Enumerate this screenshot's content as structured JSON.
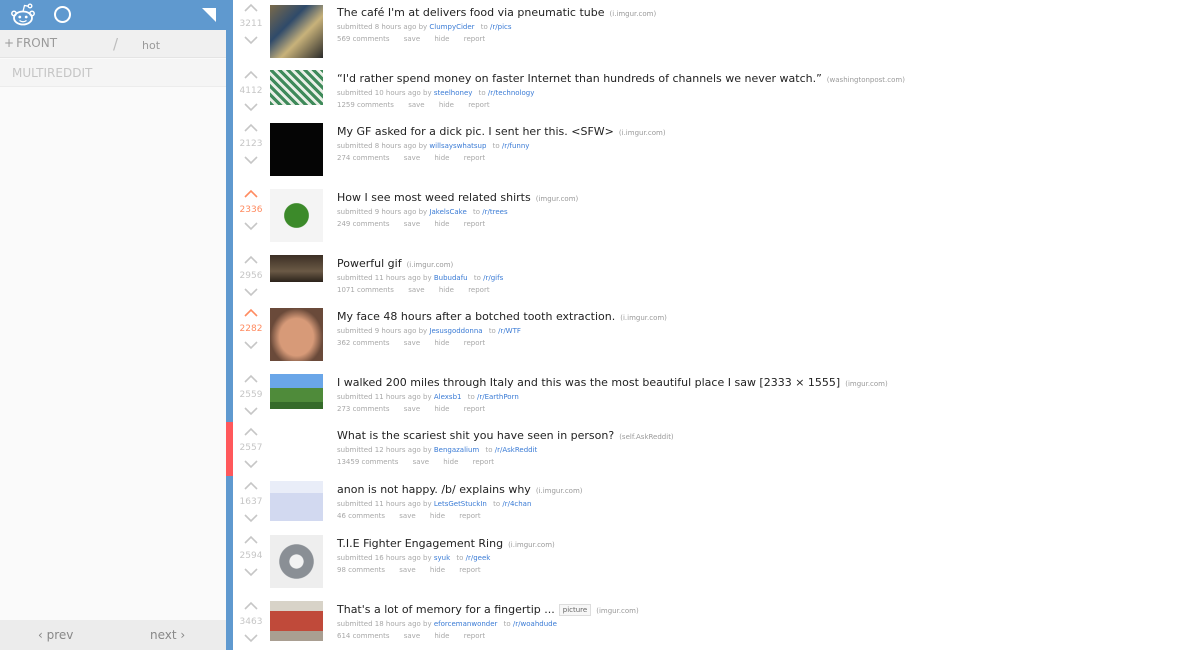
{
  "sidebar": {
    "front_label": "FRONT",
    "sort_label": "hot",
    "multireddit_label": "MULTIREDDIT",
    "prev_label": "‹ prev",
    "next_label": "next ›"
  },
  "colors": {
    "accent": "#5f99cf",
    "upvoted": "#ff8b60",
    "link": "#3a7bd5",
    "marker": "#ff585b"
  },
  "icons": {
    "logo": "reddit-alien-icon",
    "circle": "circle-icon",
    "corner": "corner-triangle-icon",
    "up": "upvote-arrow-icon",
    "down": "downvote-arrow-icon"
  },
  "posts": [
    {
      "score": "3211",
      "upvoted": false,
      "title": "The café I'm at delivers food via pneumatic tube",
      "domain": "(i.imgur.com)",
      "flair": "",
      "submitted": "submitted 8 hours ago by",
      "author": "ClumpyCider",
      "to": "to",
      "subreddit": "/r/pics",
      "comments": "569 comments",
      "save": "save",
      "hide": "hide",
      "report": "report"
    },
    {
      "score": "4112",
      "upvoted": false,
      "title": "“I'd rather spend money on faster Internet than hundreds of channels we never watch.”",
      "domain": "(washingtonpost.com)",
      "flair": "",
      "submitted": "submitted 10 hours ago by",
      "author": "steelhoney",
      "to": "to",
      "subreddit": "/r/technology",
      "comments": "1259 comments",
      "save": "save",
      "hide": "hide",
      "report": "report"
    },
    {
      "score": "2123",
      "upvoted": false,
      "title": "My GF asked for a dick pic. I sent her this. <SFW>",
      "domain": "(i.imgur.com)",
      "flair": "",
      "submitted": "submitted 8 hours ago by",
      "author": "willsayswhatsup",
      "to": "to",
      "subreddit": "/r/funny",
      "comments": "274 comments",
      "save": "save",
      "hide": "hide",
      "report": "report"
    },
    {
      "score": "2336",
      "upvoted": true,
      "title": "How I see most weed related shirts",
      "domain": "(imgur.com)",
      "flair": "",
      "submitted": "submitted 9 hours ago by",
      "author": "JakelsCake",
      "to": "to",
      "subreddit": "/r/trees",
      "comments": "249 comments",
      "save": "save",
      "hide": "hide",
      "report": "report"
    },
    {
      "score": "2956",
      "upvoted": false,
      "title": "Powerful gif",
      "domain": "(i.imgur.com)",
      "flair": "",
      "submitted": "submitted 11 hours ago by",
      "author": "Bubudafu",
      "to": "to",
      "subreddit": "/r/gifs",
      "comments": "1071 comments",
      "save": "save",
      "hide": "hide",
      "report": "report"
    },
    {
      "score": "2282",
      "upvoted": true,
      "title": "My face 48 hours after a botched tooth extraction.",
      "domain": "(i.imgur.com)",
      "flair": "",
      "submitted": "submitted 9 hours ago by",
      "author": "Jesusgoddonna",
      "to": "to",
      "subreddit": "/r/WTF",
      "comments": "362 comments",
      "save": "save",
      "hide": "hide",
      "report": "report"
    },
    {
      "score": "2559",
      "upvoted": false,
      "title": "I walked 200 miles through Italy and this was the most beautiful place I saw [2333 × 1555]",
      "domain": "(imgur.com)",
      "flair": "",
      "submitted": "submitted 11 hours ago by",
      "author": "Alexsb1",
      "to": "to",
      "subreddit": "/r/EarthPorn",
      "comments": "273 comments",
      "save": "save",
      "hide": "hide",
      "report": "report"
    },
    {
      "score": "2557",
      "upvoted": false,
      "title": "What is the scariest shit you have seen in person?",
      "domain": "(self.AskReddit)",
      "flair": "",
      "submitted": "submitted 12 hours ago by",
      "author": "Bengazalium",
      "to": "to",
      "subreddit": "/r/AskReddit",
      "comments": "13459 comments",
      "save": "save",
      "hide": "hide",
      "report": "report"
    },
    {
      "score": "1637",
      "upvoted": false,
      "title": "anon is not happy. /b/ explains why",
      "domain": "(i.imgur.com)",
      "flair": "",
      "submitted": "submitted 11 hours ago by",
      "author": "LetsGetStuckIn",
      "to": "to",
      "subreddit": "/r/4chan",
      "comments": "46 comments",
      "save": "save",
      "hide": "hide",
      "report": "report"
    },
    {
      "score": "2594",
      "upvoted": false,
      "title": "T.I.E Fighter Engagement Ring",
      "domain": "(i.imgur.com)",
      "flair": "",
      "submitted": "submitted 16 hours ago by",
      "author": "syuk",
      "to": "to",
      "subreddit": "/r/geek",
      "comments": "98 comments",
      "save": "save",
      "hide": "hide",
      "report": "report"
    },
    {
      "score": "3463",
      "upvoted": false,
      "title": "That's a lot of memory for a fingertip ...",
      "domain": "(imgur.com)",
      "flair": "picture",
      "submitted": "submitted 18 hours ago by",
      "author": "eforcemanwonder",
      "to": "to",
      "subreddit": "/r/woahdude",
      "comments": "614 comments",
      "save": "save",
      "hide": "hide",
      "report": "report"
    }
  ]
}
